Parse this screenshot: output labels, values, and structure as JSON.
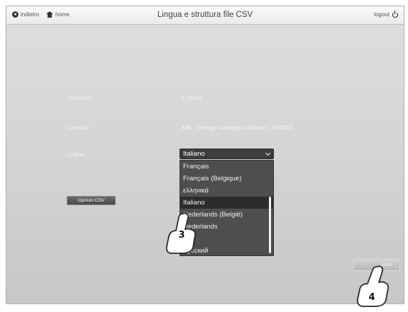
{
  "header": {
    "back_label": "indietro",
    "home_label": "home",
    "title": "Lingua e struttura file CSV",
    "logout_label": "logout"
  },
  "form": {
    "version_label": "Versione :",
    "version_value": "1.15.00",
    "license_label": "Licenza :",
    "license_value": "IME - Energy manager software - SXS255",
    "language_label": "Lingua :",
    "language_selected": "Italiano"
  },
  "dropdown": {
    "options": [
      {
        "label": "Français"
      },
      {
        "label": "Français (Belgique)"
      },
      {
        "label": "ελληνικά"
      },
      {
        "label": "Italiano",
        "selected": true
      },
      {
        "label": "Nederlands (België)"
      },
      {
        "label": "Nederlands"
      },
      {
        "label": ""
      },
      {
        "label": "Русский"
      }
    ]
  },
  "buttons": {
    "csv_options": "Opzioni CSV",
    "save": "Salva"
  },
  "callouts": {
    "step_3": "3",
    "step_4": "4"
  },
  "icons": {
    "back": "back-circle-icon",
    "home": "home-icon",
    "logout": "power-icon",
    "chevron": "chevron-down-icon",
    "pointer": "hand-pointer-icon"
  }
}
